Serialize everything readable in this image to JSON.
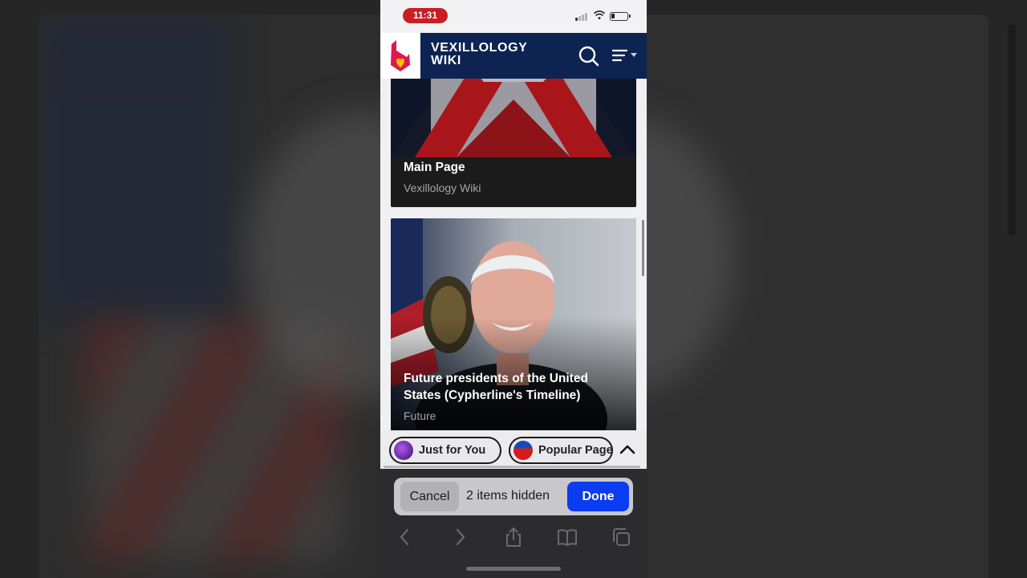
{
  "status_bar": {
    "time": "11:31"
  },
  "wiki_header": {
    "title_line1": "VEXILLOLOGY",
    "title_line2": "WIKI",
    "logo_icon": "fandom-heart-icon",
    "search_icon": "search-icon",
    "menu_icon": "menu-icon"
  },
  "cards": [
    {
      "title": "Main Page",
      "subtitle": "Vexillology Wiki"
    },
    {
      "title": "Future presidents of the United States (Cypherline's Timeline)",
      "subtitle": "Future"
    }
  ],
  "suggestions": {
    "chips": [
      {
        "label": "Just for You",
        "icon": "purple-avatar-icon"
      },
      {
        "label": "Popular Pages",
        "icon": "flag-circle-icon"
      }
    ],
    "collapse_icon": "chevron-up-icon"
  },
  "hide_bar": {
    "cancel_label": "Cancel",
    "status_text": "2 items hidden",
    "done_label": "Done"
  },
  "browser_nav": [
    "back-icon",
    "forward-icon",
    "share-icon",
    "bookmarks-icon",
    "tabs-icon"
  ],
  "colors": {
    "wiki_header_bg": "#0d2352",
    "time_pill": "#c81e24",
    "done_button": "#0a3cf0"
  }
}
